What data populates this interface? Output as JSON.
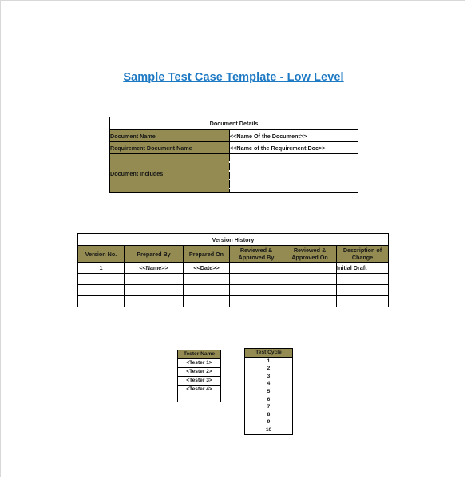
{
  "page": {
    "title": "Sample Test Case Template - Low Level",
    "title_color": "#1f7ac4",
    "header_fill": "#938b52",
    "banner_text_color": "#c00000"
  },
  "document_details": {
    "banner": "Document Details",
    "rows": [
      {
        "label": "Document Name",
        "value": "<<Name Of the Document>>"
      },
      {
        "label": "Requirement Document Name",
        "value": "<<Name of the Requirement Doc>>"
      },
      {
        "label": "Document Includes",
        "value": ""
      }
    ]
  },
  "version_history": {
    "banner": "Version History",
    "columns": [
      "Version No.",
      "Prepared By",
      "Prepared On",
      "Reviewed &\nApproved By",
      "Reviewed &\nApproved On",
      "Description of\nChange"
    ],
    "columns_display": {
      "c0": "Version No.",
      "c1": "Prepared By",
      "c2": "Prepared On",
      "c3a": "Reviewed &",
      "c3b": "Approved By",
      "c4a": "Reviewed &",
      "c4b": "Approved On",
      "c5a": "Description of",
      "c5b": "Change"
    },
    "rows": [
      {
        "version_no": "1",
        "prepared_by": "<<Name>>",
        "prepared_on": "<<Date>>",
        "reviewed_approved_by": "",
        "reviewed_approved_on": "",
        "description_of_change": "Initial Draft"
      },
      {
        "version_no": "",
        "prepared_by": "",
        "prepared_on": "",
        "reviewed_approved_by": "",
        "reviewed_approved_on": "",
        "description_of_change": ""
      },
      {
        "version_no": "",
        "prepared_by": "",
        "prepared_on": "",
        "reviewed_approved_by": "",
        "reviewed_approved_on": "",
        "description_of_change": ""
      },
      {
        "version_no": "",
        "prepared_by": "",
        "prepared_on": "",
        "reviewed_approved_by": "",
        "reviewed_approved_on": "",
        "description_of_change": ""
      }
    ]
  },
  "tester_name": {
    "header": "Tester Name",
    "values": [
      "<Tester 1>",
      "<Tester 2>",
      "<Tester 3>",
      "<Tester 4>"
    ]
  },
  "test_cycle": {
    "header": "Test Cycle",
    "values": [
      "1",
      "2",
      "3",
      "4",
      "5",
      "6",
      "7",
      "8",
      "9",
      "10"
    ]
  }
}
